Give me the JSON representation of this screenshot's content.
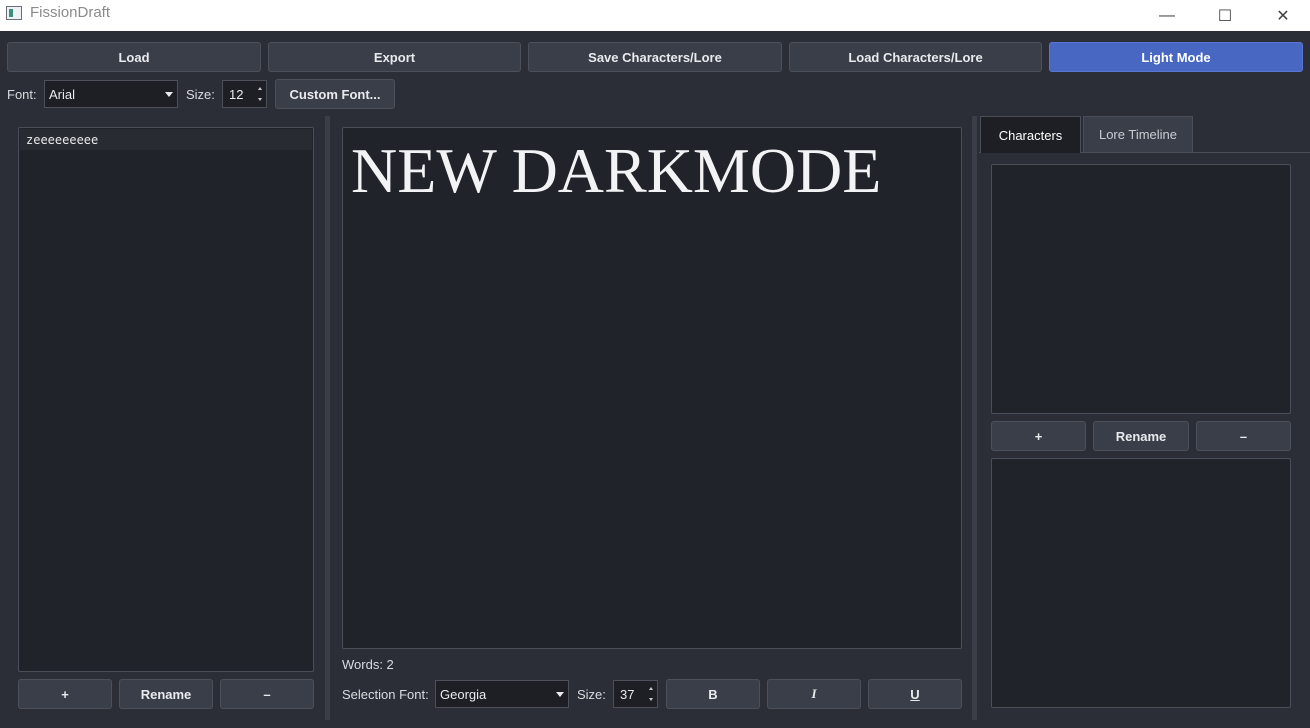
{
  "window": {
    "title": "FissionDraft",
    "controls": {
      "minimize": "—",
      "maximize": "☐",
      "close": "✕"
    }
  },
  "toolbar": {
    "load": "Load",
    "export": "Export",
    "save_chars": "Save Characters/Lore",
    "load_chars": "Load Characters/Lore",
    "light_mode": "Light Mode",
    "accent_color": "#4767c3"
  },
  "font_bar": {
    "font_label": "Font:",
    "font_value": "Arial",
    "size_label": "Size:",
    "size_value": "12",
    "custom_font": "Custom Font..."
  },
  "documents": {
    "items": [
      "zeeeeeeeee"
    ],
    "add": "+",
    "rename": "Rename",
    "remove": "–"
  },
  "editor": {
    "content": "NEW DARKMODE",
    "word_count": "Words: 2",
    "selection_font_label": "Selection Font:",
    "selection_font_value": "Georgia",
    "size_label": "Size:",
    "size_value": "37",
    "bold": "B",
    "italic": "I",
    "underline": "U"
  },
  "side_panel": {
    "tabs": [
      "Characters",
      "Lore Timeline"
    ],
    "active_tab": "Characters",
    "add": "+",
    "rename": "Rename",
    "remove": "–"
  }
}
